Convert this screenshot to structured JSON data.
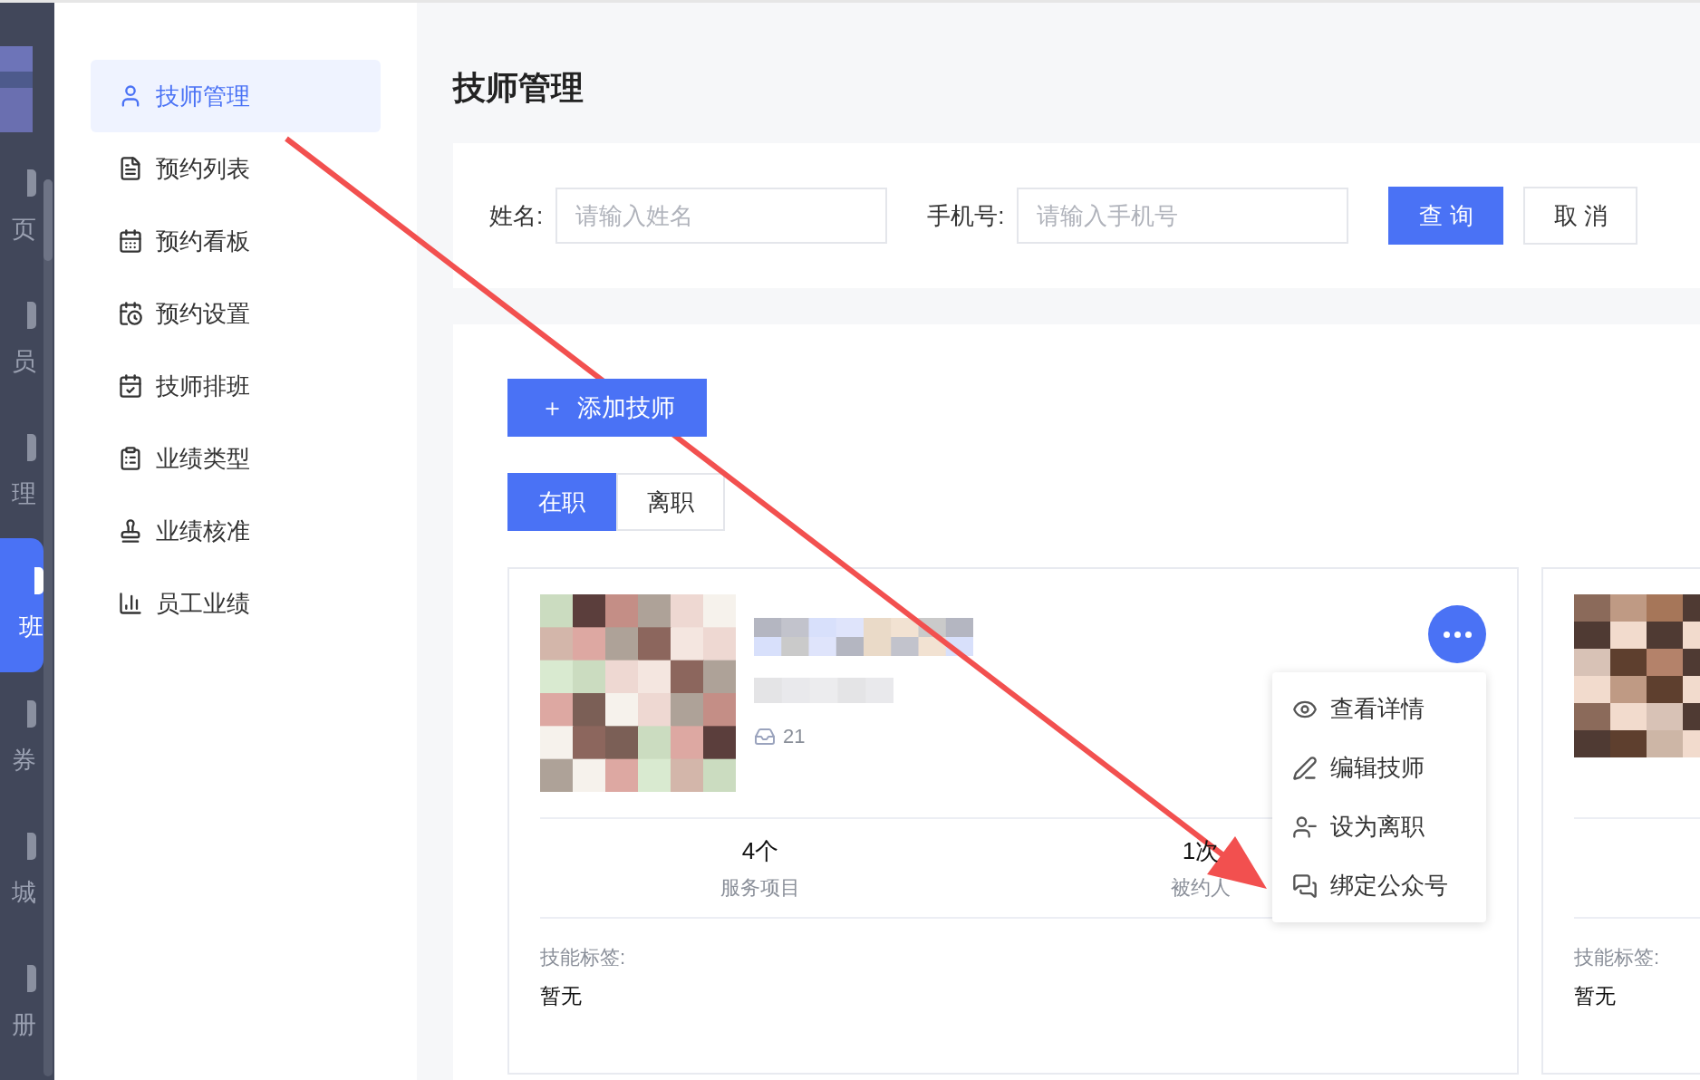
{
  "rail": {
    "items": [
      {
        "label": "页",
        "selected": false
      },
      {
        "label": "员",
        "selected": false
      },
      {
        "label": "理",
        "selected": false
      },
      {
        "label": "班",
        "selected": true
      },
      {
        "label": "券",
        "selected": false
      },
      {
        "label": "城",
        "selected": false
      },
      {
        "label": "册",
        "selected": false
      }
    ]
  },
  "submenu": {
    "items": [
      {
        "kind": "user",
        "label": "技师管理",
        "selected": true
      },
      {
        "kind": "list",
        "label": "预约列表",
        "selected": false
      },
      {
        "kind": "board",
        "label": "预约看板",
        "selected": false
      },
      {
        "kind": "clock",
        "label": "预约设置",
        "selected": false
      },
      {
        "kind": "schedule",
        "label": "技师排班",
        "selected": false
      },
      {
        "kind": "type",
        "label": "业绩类型",
        "selected": false
      },
      {
        "kind": "stamp",
        "label": "业绩核准",
        "selected": false
      },
      {
        "kind": "chart",
        "label": "员工业绩",
        "selected": false
      }
    ]
  },
  "page_title": "技师管理",
  "search": {
    "fields": [
      {
        "label": "姓名:",
        "placeholder": "请输入姓名"
      },
      {
        "label": "手机号:",
        "placeholder": "请输入手机号"
      }
    ],
    "buttons": [
      {
        "kind": "primary",
        "label": "查 询"
      },
      {
        "kind": "default",
        "label": "取 消"
      }
    ]
  },
  "add_button": {
    "icon": "＋",
    "label": "添加技师"
  },
  "status_tabs": [
    {
      "label": "在职",
      "selected": true
    },
    {
      "label": "离职",
      "selected": false
    }
  ],
  "cards": [
    {
      "count": "21",
      "menu_open": true,
      "stats": [
        {
          "value": "4个",
          "label": "服务项目"
        },
        {
          "value": "1次",
          "label": "被约人"
        }
      ],
      "skill_label": "技能标签:",
      "skill_value": "暂无"
    },
    {
      "menu_open": false,
      "skill_label": "技能标签:",
      "skill_value": "暂无"
    }
  ],
  "action_menu": [
    {
      "kind": "view",
      "label": "查看详情"
    },
    {
      "kind": "edit",
      "label": "编辑技师"
    },
    {
      "kind": "leave",
      "label": "设为离职"
    },
    {
      "kind": "wechat",
      "label": "绑定公众号"
    }
  ]
}
